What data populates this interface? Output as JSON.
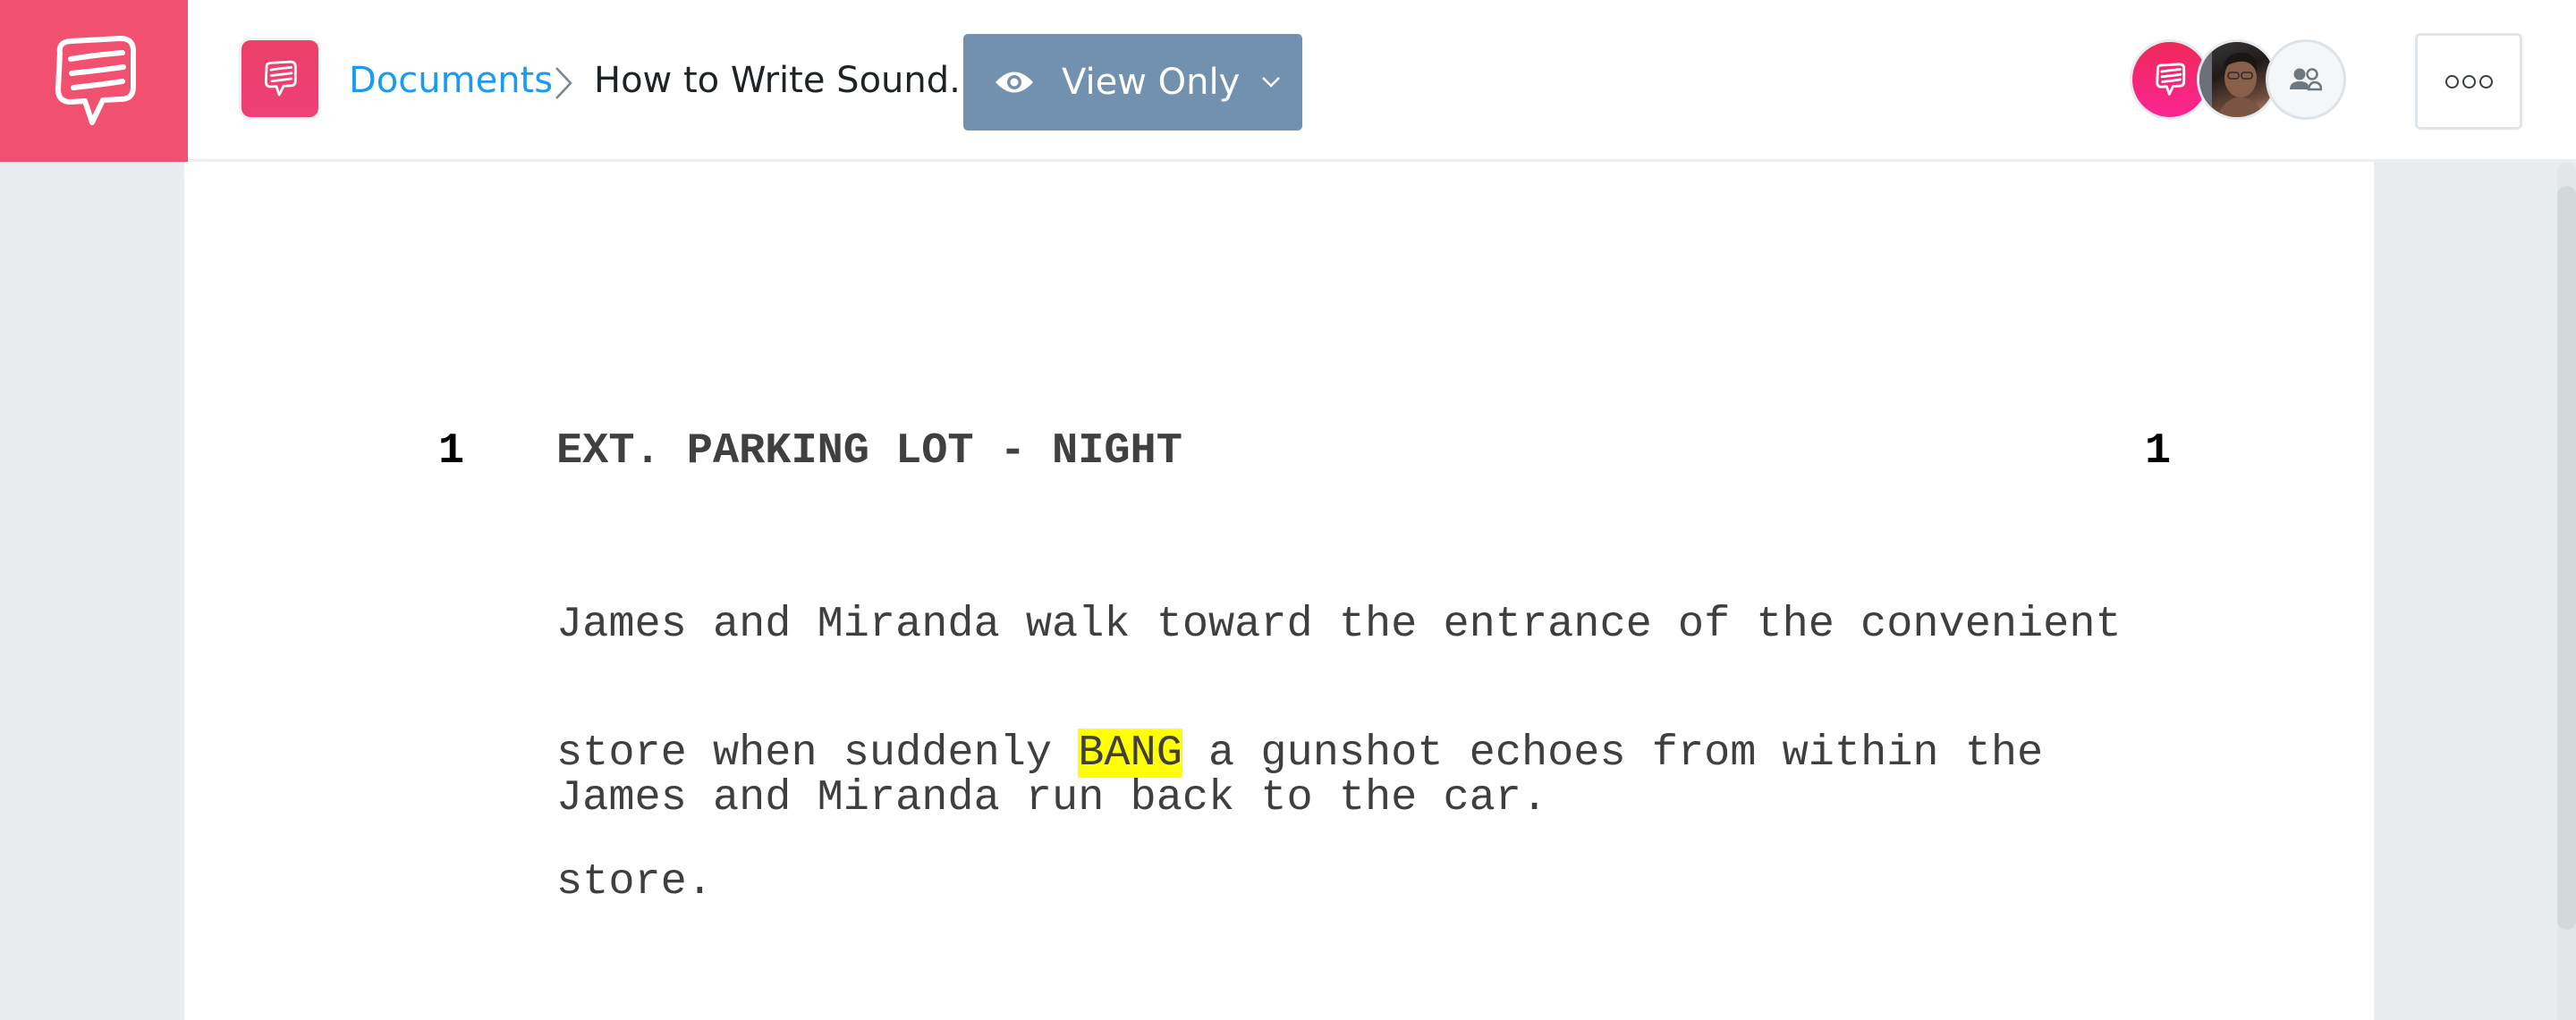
{
  "app": {
    "brand_color": "#f2506f",
    "logo_icon": "chat-bubble-lines-icon"
  },
  "header": {
    "doc_icon": "chat-bubble-lines-icon",
    "breadcrumb": {
      "root_label": "Documents",
      "separator_icon": "chevron-right-icon",
      "current_label": "How to Write Sound.."
    },
    "view_mode": {
      "icon": "eye-icon",
      "label": "View Only",
      "dropdown_icon": "chevron-down-icon",
      "color": "#7191ae"
    },
    "collaborators": [
      {
        "type": "brand-avatar",
        "icon": "chat-bubble-lines-icon"
      },
      {
        "type": "user-photo"
      },
      {
        "type": "share-users",
        "icon": "users-icon"
      }
    ],
    "more_menu_icon": "more-dots-icon"
  },
  "script": {
    "scene": {
      "number_left": "1",
      "number_right": "1",
      "heading": "EXT. PARKING LOT - NIGHT"
    },
    "action_1": {
      "line1": "James and Miranda walk toward the entrance of the convenient",
      "line2_before": "store when suddenly ",
      "line2_highlight": "BANG",
      "line2_after": " a gunshot echoes from within the",
      "line3": "store."
    },
    "action_2": {
      "line1": "James and Miranda run back to the car."
    },
    "highlight_color": "#ffff00"
  }
}
